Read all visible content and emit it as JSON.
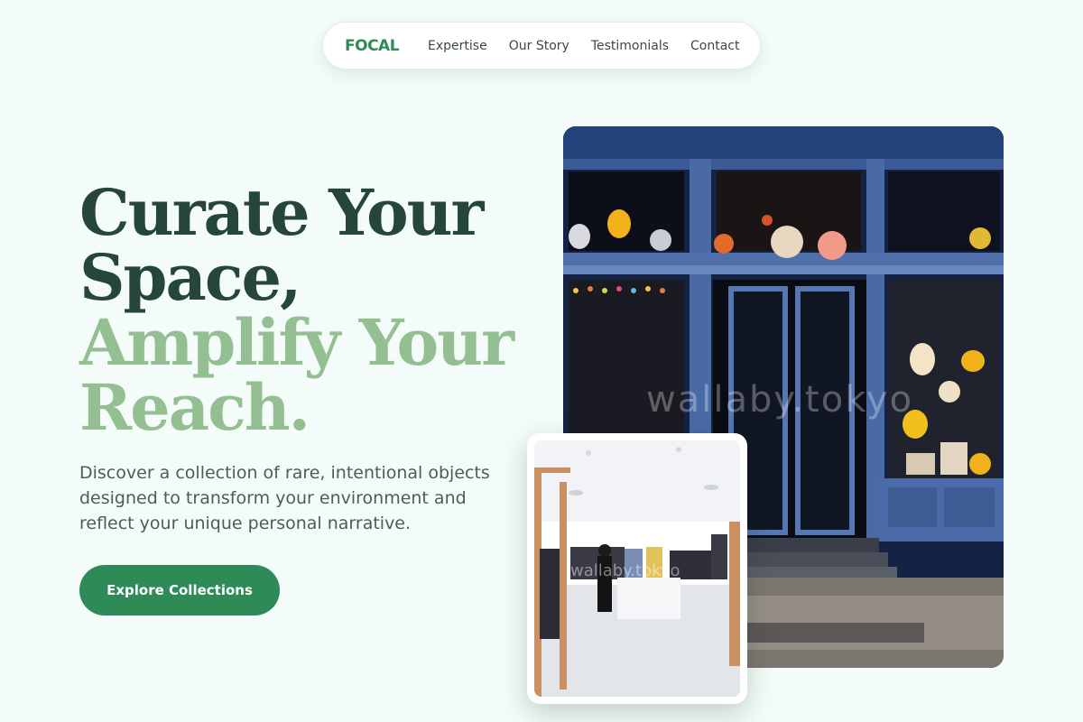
{
  "nav": {
    "logo": "FOCAL",
    "links": [
      "Expertise",
      "Our Story",
      "Testimonials",
      "Contact"
    ]
  },
  "hero": {
    "headline_line1": "Curate Your",
    "headline_line2": "Space,",
    "headline_line3": "Amplify Your",
    "headline_line4": "Reach.",
    "subtitle": "Discover a collection of rare, intentional objects designed to transform your environment and reflect your unique personal narrative.",
    "cta_label": "Explore Collections"
  },
  "images": {
    "main_watermark": "wallaby.tokyo",
    "inset_watermark": "wallaby.tokyo"
  },
  "colors": {
    "accent": "#2e8b57",
    "headline_dark": "#26463a",
    "headline_light": "#94bf92",
    "background": "#f3fcf8"
  }
}
